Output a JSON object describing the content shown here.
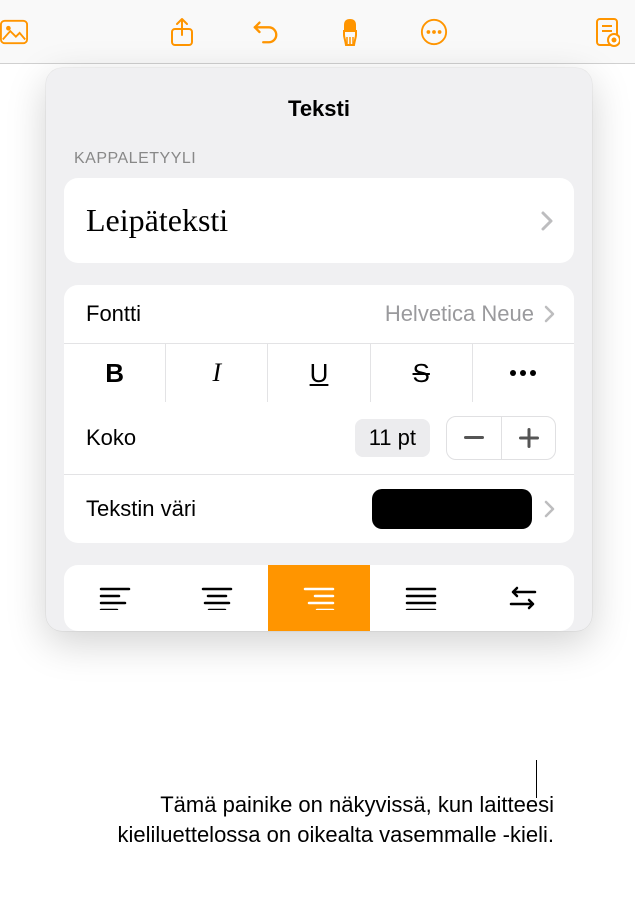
{
  "toolbar": {
    "icons": {
      "media": "media-icon",
      "share": "share-icon",
      "undo": "undo-icon",
      "format": "format-brush-icon",
      "more": "more-circle-icon",
      "document": "document-icon"
    }
  },
  "popover": {
    "title": "Teksti",
    "section_label": "KAPPALETYYLI",
    "style_name": "Leipäteksti",
    "font": {
      "label": "Fontti",
      "value": "Helvetica Neue"
    },
    "format_buttons": {
      "bold": "B",
      "italic": "I",
      "underline": "U",
      "strike": "S",
      "more": "more-icon"
    },
    "size": {
      "label": "Koko",
      "value": "11 pt"
    },
    "color": {
      "label": "Tekstin väri",
      "swatch": "#000000"
    },
    "alignment": {
      "options": [
        "left",
        "center",
        "right",
        "justify",
        "rtl"
      ],
      "active": "right"
    }
  },
  "callout": {
    "text": "Tämä painike on näkyvissä, kun laitteesi kieliluettelossa on oikealta vasemmalle -kieli."
  }
}
